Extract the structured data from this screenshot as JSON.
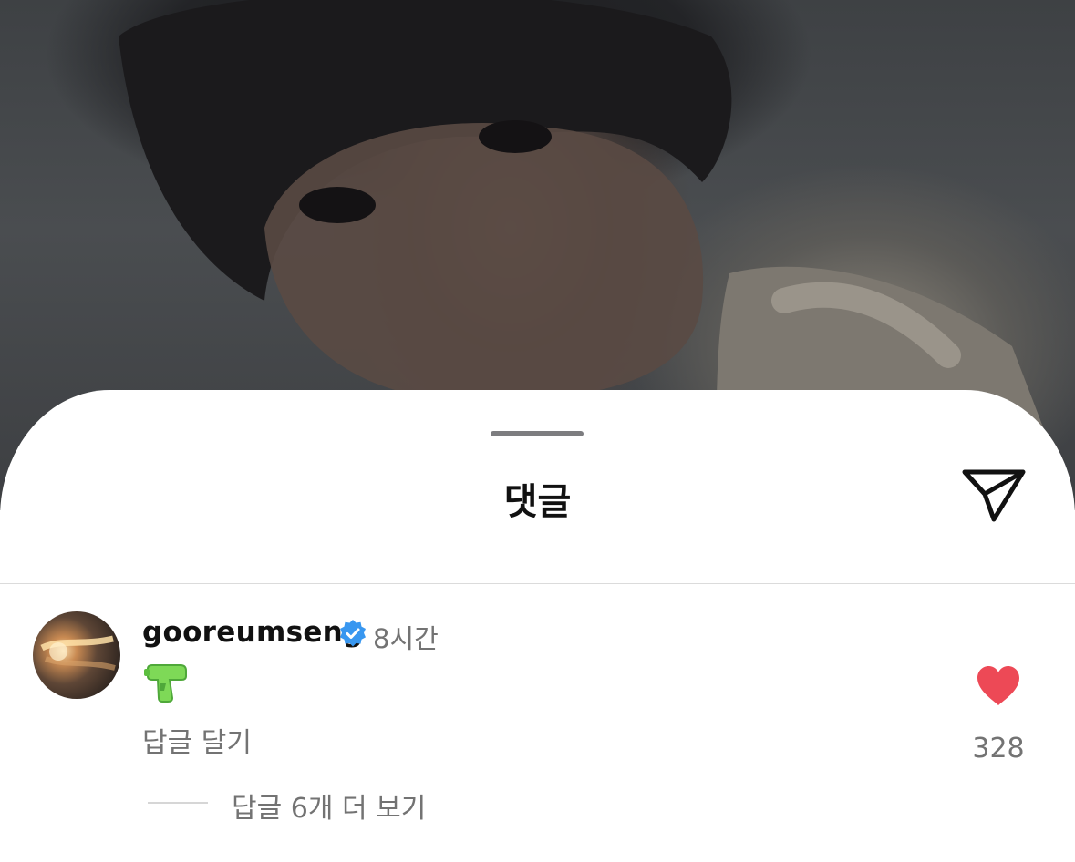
{
  "sheet": {
    "title": "댓글"
  },
  "comment": {
    "username": "gooreumseng",
    "verified": true,
    "time": "8시간",
    "content_icon": "water-pistol-emoji",
    "reply_label": "답글 달기",
    "view_replies_label": "답글 6개 더 보기",
    "like_count": "328"
  },
  "colors": {
    "like": "#ED4956",
    "verified": "#3897F0",
    "secondary_text": "#737373"
  }
}
